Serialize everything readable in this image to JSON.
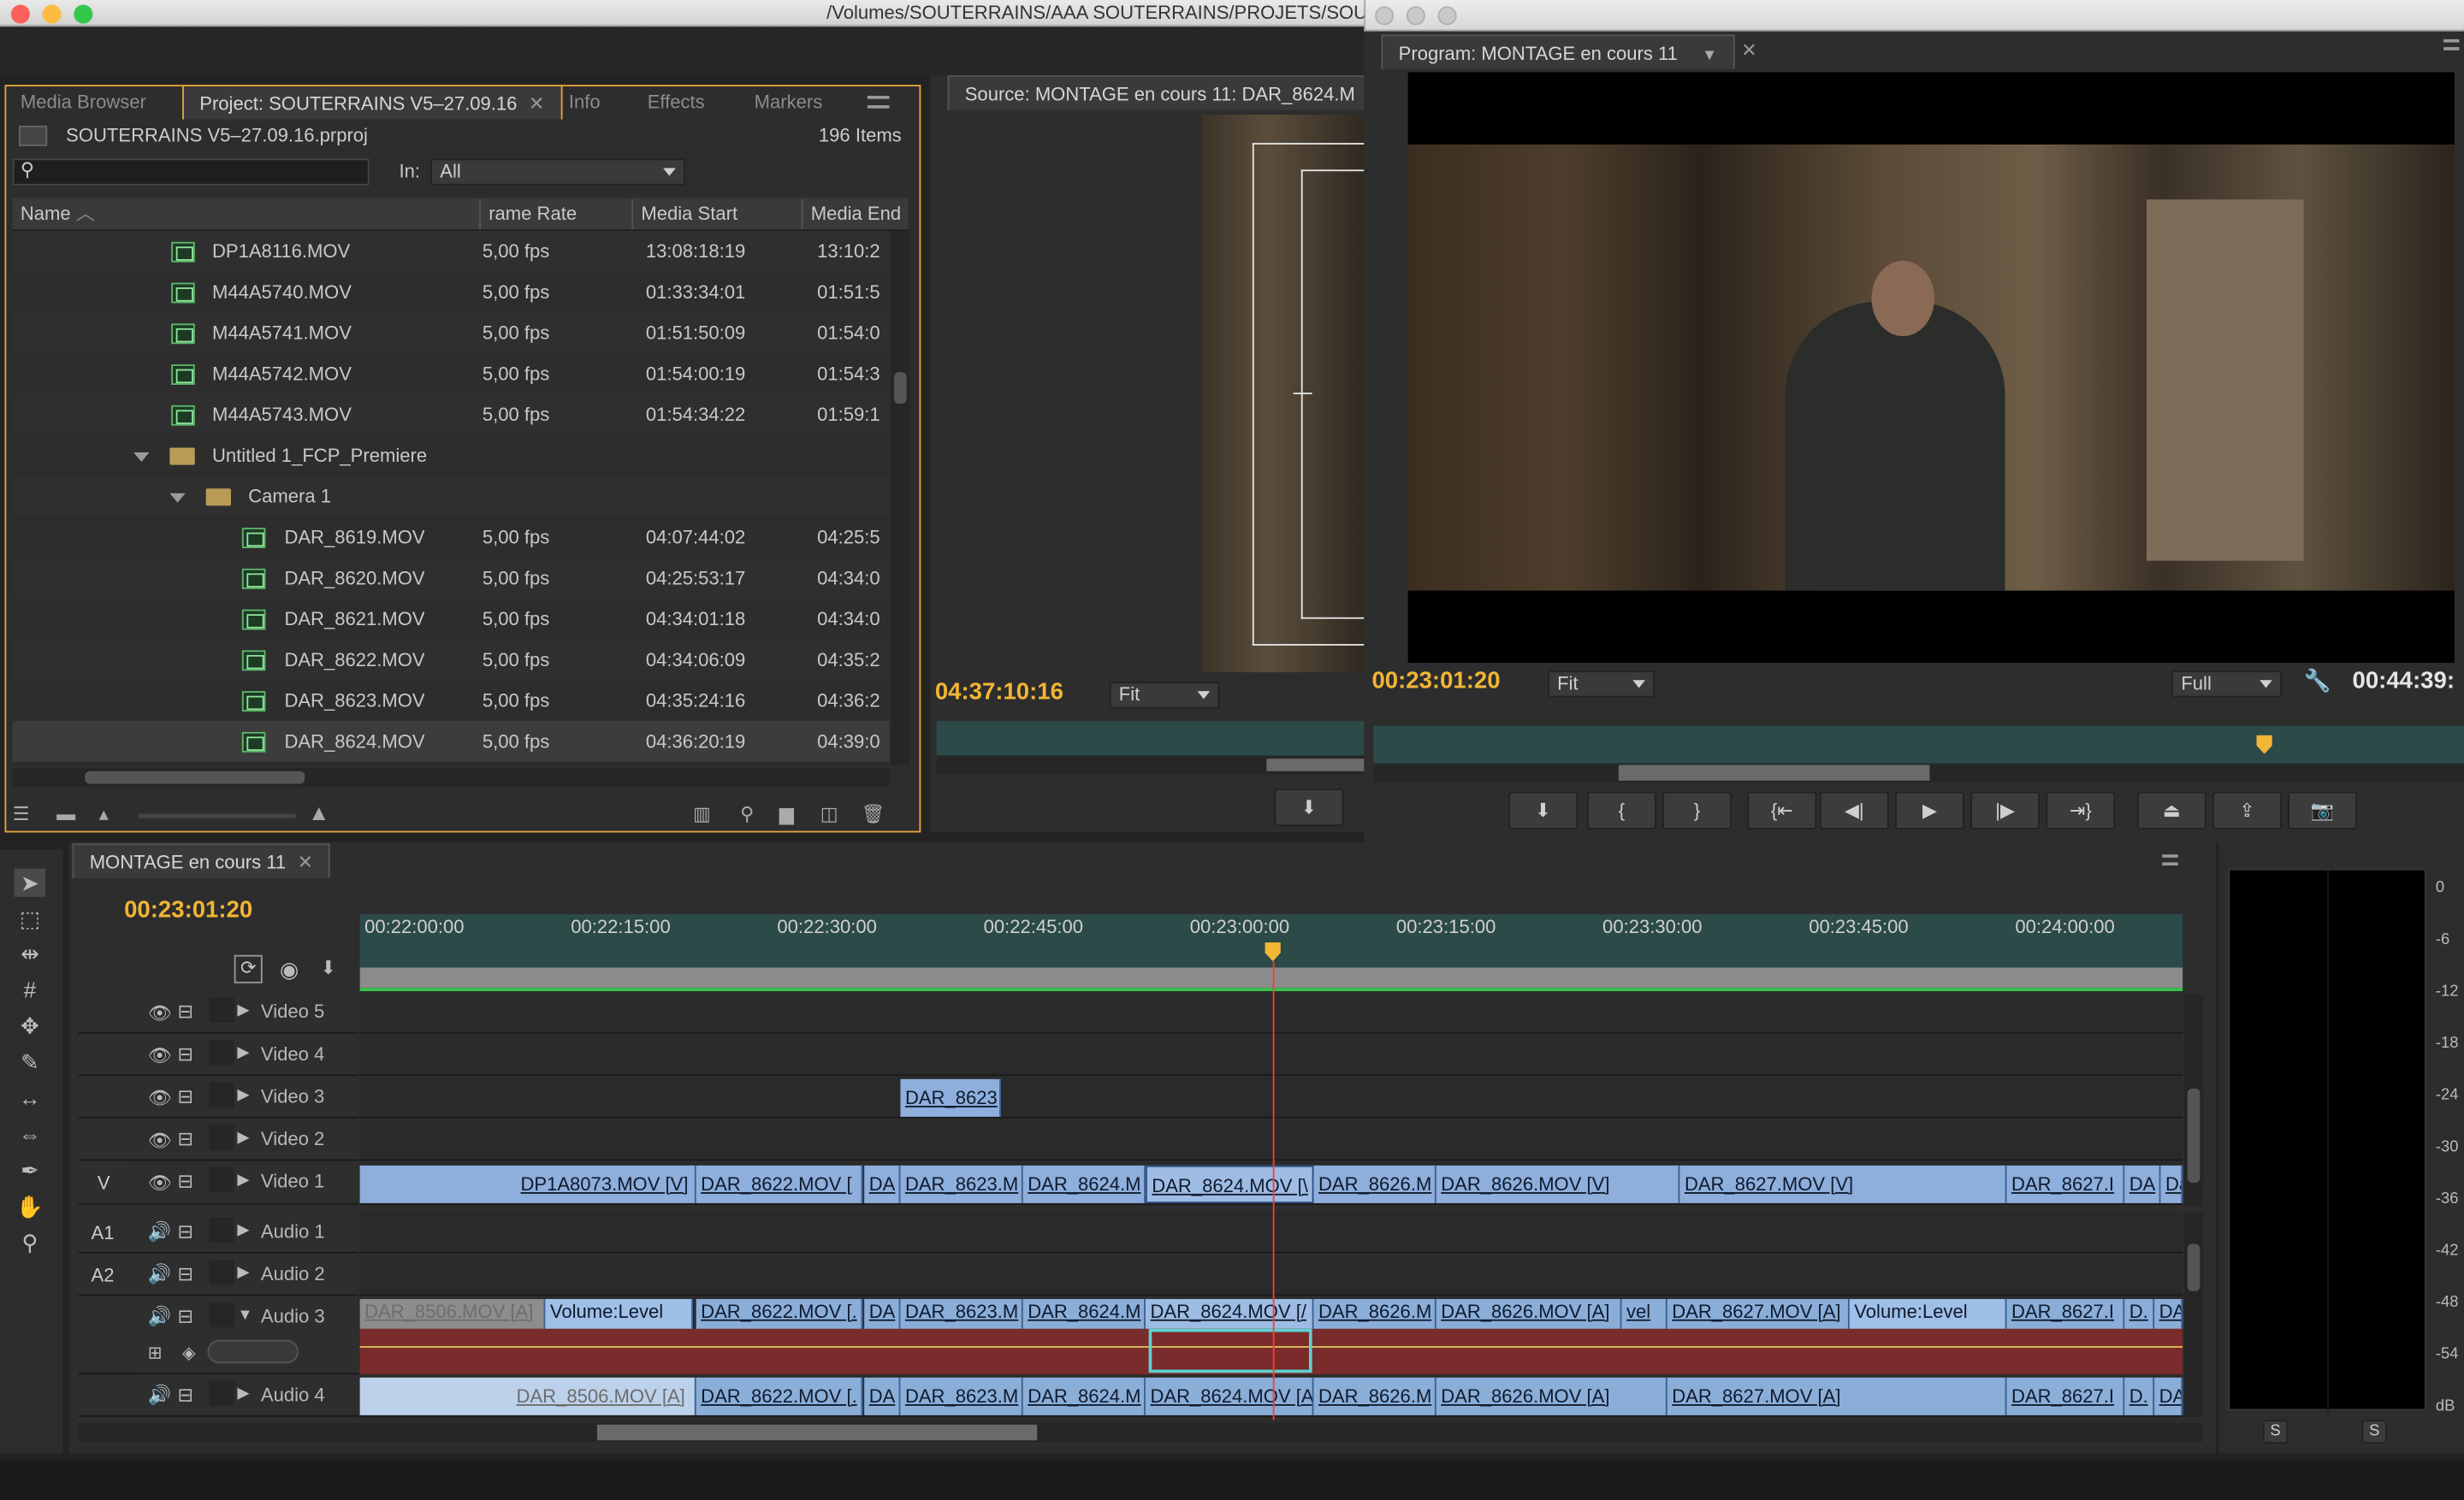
{
  "window": {
    "title_path": "/Volumes/SOUTERRAINS/AAA SOUTERRAINS/PROJETS/SOU"
  },
  "project_panel": {
    "tabs": [
      "Media Browser",
      "Project: SOUTERRAINS V5–27.09.16",
      "Info",
      "Effects",
      "Markers"
    ],
    "project_file": "SOUTERRAINS V5–27.09.16.prproj",
    "item_count": "196 Items",
    "in_label": "In:",
    "in_value": "All",
    "columns": [
      "Name",
      "rame Rate",
      "Media Start",
      "Media End"
    ],
    "rows": [
      {
        "name": "DP1A8116.MOV",
        "rate": "5,00 fps",
        "start": "13:08:18:19",
        "end": "13:10:2"
      },
      {
        "name": "M44A5740.MOV",
        "rate": "5,00 fps",
        "start": "01:33:34:01",
        "end": "01:51:5"
      },
      {
        "name": "M44A5741.MOV",
        "rate": "5,00 fps",
        "start": "01:51:50:09",
        "end": "01:54:0"
      },
      {
        "name": "M44A5742.MOV",
        "rate": "5,00 fps",
        "start": "01:54:00:19",
        "end": "01:54:3"
      },
      {
        "name": "M44A5743.MOV",
        "rate": "5,00 fps",
        "start": "01:54:34:22",
        "end": "01:59:1"
      },
      {
        "name": "Untitled 1_FCP_Premiere",
        "rate": "",
        "start": "",
        "end": ""
      },
      {
        "name": "Camera 1",
        "rate": "",
        "start": "",
        "end": ""
      },
      {
        "name": "DAR_8619.MOV",
        "rate": "5,00 fps",
        "start": "04:07:44:02",
        "end": "04:25:5"
      },
      {
        "name": "DAR_8620.MOV",
        "rate": "5,00 fps",
        "start": "04:25:53:17",
        "end": "04:34:0"
      },
      {
        "name": "DAR_8621.MOV",
        "rate": "5,00 fps",
        "start": "04:34:01:18",
        "end": "04:34:0"
      },
      {
        "name": "DAR_8622.MOV",
        "rate": "5,00 fps",
        "start": "04:34:06:09",
        "end": "04:35:2"
      },
      {
        "name": "DAR_8623.MOV",
        "rate": "5,00 fps",
        "start": "04:35:24:16",
        "end": "04:36:2"
      },
      {
        "name": "DAR_8624.MOV",
        "rate": "5,00 fps",
        "start": "04:36:20:19",
        "end": "04:39:0"
      }
    ]
  },
  "source_monitor": {
    "title": "Source: MONTAGE en cours 11: DAR_8624.M",
    "timecode": "04:37:10:16",
    "zoom": "Fit"
  },
  "program_monitor": {
    "title": "Program: MONTAGE en cours 11",
    "timecode": "00:23:01:20",
    "zoom": "Fit",
    "quality": "Full",
    "duration": "00:44:39:"
  },
  "timeline": {
    "sequence_tab": "MONTAGE en cours 11",
    "timecode": "00:23:01:20",
    "ruler": [
      "00:22:00:00",
      "00:22:15:00",
      "00:22:30:00",
      "00:22:45:00",
      "00:23:00:00",
      "00:23:15:00",
      "00:23:30:00",
      "00:23:45:00",
      "00:24:00:00"
    ],
    "video_tracks": [
      "Video 5",
      "Video 4",
      "Video 3",
      "Video 2",
      "Video 1"
    ],
    "audio_tracks": [
      "Audio 1",
      "Audio 2",
      "Audio 3",
      "Audio 4"
    ],
    "src_v": "V",
    "src_a1": "A1",
    "src_a2": "A2",
    "v3_clip": "DAR_8623",
    "v1_clips": [
      "DP1A8073.MOV [V]",
      "DAR_8622.MOV [",
      "DA",
      "DAR_8623.M",
      "DAR_8624.M",
      "DAR_8624.MOV [\\",
      "DAR_8626.M",
      "DAR_8626.MOV [V]",
      "DAR_8627.MOV [V]",
      "DAR_8627.I",
      "DA",
      "Da"
    ],
    "a3_clips": [
      "DAR_8506.MOV [A]",
      "Volume:Level",
      "DAR_8622.MOV [.",
      "DA",
      "DAR_8623.M",
      "DAR_8624.M",
      "DAR_8624.MOV [/",
      "DAR_8626.M",
      "DAR_8626.MOV [A]",
      "vel",
      "DAR_8627.MOV [A]",
      "Volume:Level",
      "DAR_8627.I",
      "D.",
      "DA"
    ],
    "a4_clips": [
      "DAR_8506.MOV [A]",
      "DAR_8622.MOV [.",
      "DA",
      "DAR_8623.M",
      "DAR_8624.M",
      "DAR_8624.MOV [A]",
      "DAR_8626.M",
      "DAR_8626.MOV [A]",
      "DAR_8627.MOV [A]",
      "DAR_8627.I",
      "D.",
      "DA"
    ]
  },
  "audio_meter": {
    "scale": [
      "0",
      "-6",
      "-12",
      "-18",
      "-24",
      "-30",
      "-36",
      "-42",
      "-48",
      "-54",
      "dB"
    ],
    "solo": "S"
  }
}
